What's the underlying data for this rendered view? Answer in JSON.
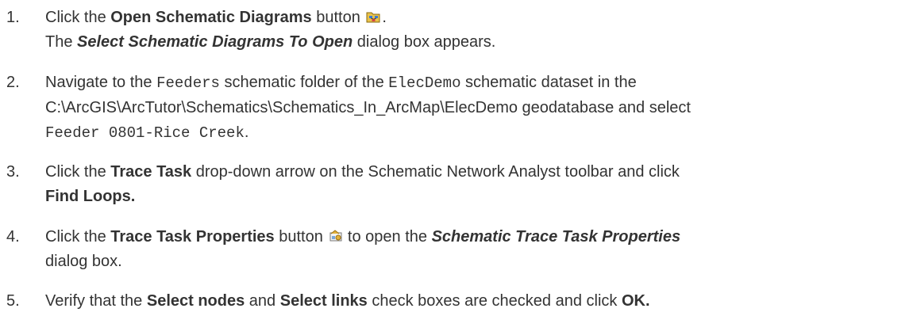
{
  "steps": [
    {
      "num": "1.",
      "a": "Click the ",
      "b": "Open Schematic Diagrams",
      "c": " button ",
      "icon": "open-schematic-diagrams-icon",
      "d": ".",
      "e": "The ",
      "f": "Select Schematic Diagrams To Open",
      "g": " dialog box appears."
    },
    {
      "num": "2.",
      "a": "Navigate to the ",
      "b": "Feeders",
      "c": " schematic folder of the ",
      "d": "ElecDemo",
      "e": " schematic dataset in the",
      "f": "C:\\ArcGIS\\ArcTutor\\Schematics\\Schematics_In_ArcMap\\ElecDemo geodatabase and select",
      "g": "Feeder 0801-Rice Creek",
      "h": "."
    },
    {
      "num": "3.",
      "a": "Click the ",
      "b": "Trace Task",
      "c": " drop-down arrow on the Schematic Network Analyst toolbar and click",
      "d": "Find Loops."
    },
    {
      "num": "4.",
      "a": "Click the ",
      "b": "Trace Task Properties",
      "c": " button ",
      "icon": "trace-task-properties-icon",
      "d": " to open the ",
      "e": "Schematic Trace Task Properties",
      "f": "dialog box."
    },
    {
      "num": "5.",
      "a": "Verify that the ",
      "b": "Select nodes",
      "c": " and ",
      "d": "Select links",
      "e": " check boxes are checked and click ",
      "f": "OK."
    }
  ]
}
